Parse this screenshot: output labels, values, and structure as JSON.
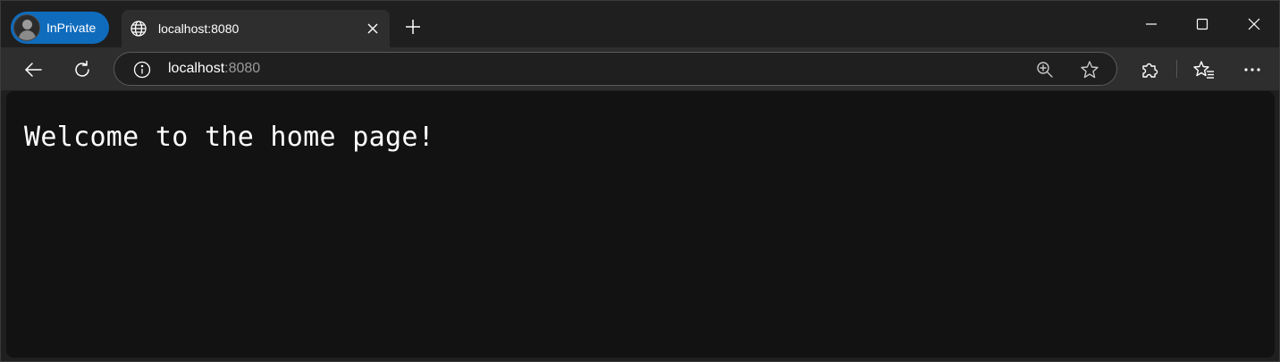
{
  "browser": {
    "profile_label": "InPrivate",
    "tab": {
      "title": "localhost:8080"
    },
    "address": {
      "host": "localhost",
      "port": ":8080"
    },
    "colors": {
      "accent": "#0f6cbd",
      "chrome": "#2e2e2e",
      "page_background": "#121212"
    },
    "icons": {
      "tab_favicon": "globe-icon",
      "tab_close": "close-icon",
      "new_tab": "plus-icon",
      "back": "back-arrow-icon",
      "refresh": "refresh-icon",
      "site_info": "info-icon",
      "zoom": "zoom-in-icon",
      "favorite": "star-icon",
      "extensions": "puzzle-icon",
      "favorites_bar": "favorites-icon",
      "menu": "more-icon",
      "minimize": "minimize-icon",
      "maximize": "maximize-icon",
      "close_window": "close-icon"
    }
  },
  "page": {
    "heading": "Welcome to the home page!"
  }
}
